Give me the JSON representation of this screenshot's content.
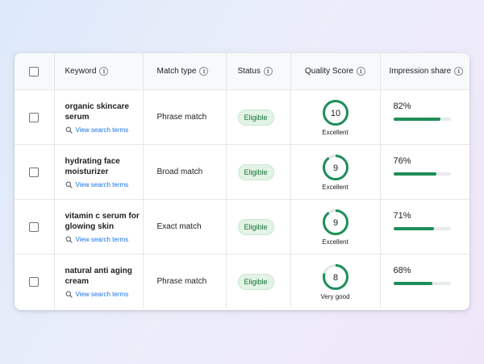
{
  "colors": {
    "link": "#1a73e8",
    "eligible_bg": "#e3f3e6",
    "eligible_text": "#137333",
    "progress": "#1e8e5a",
    "ring": "#1e8e5a"
  },
  "headers": {
    "keyword": "Keyword",
    "match_type": "Match type",
    "status": "Status",
    "quality_score": "Quality Score",
    "impression_share": "Impression share"
  },
  "rows": [
    {
      "keyword_line1": "organic skincare",
      "keyword_line2": "serum",
      "link": "View search terms",
      "match_type": "Phrase match",
      "status": "Eligible",
      "quality_score": "10",
      "quality_fraction": 1.0,
      "quality_label": "Excellent",
      "impression_share": "82%",
      "impression_fraction": 0.82
    },
    {
      "keyword_line1": "hydrating face",
      "keyword_line2": "moisturizer",
      "link": "View search terms",
      "match_type": "Broad match",
      "status": "Eligible",
      "quality_score": "9",
      "quality_fraction": 0.9,
      "quality_label": "Excellent",
      "impression_share": "76%",
      "impression_fraction": 0.76
    },
    {
      "keyword_line1": "vitamin c serum for",
      "keyword_line2": "glowing skin",
      "link": "View search terms",
      "match_type": "Exact match",
      "status": "Eligible",
      "quality_score": "9",
      "quality_fraction": 0.9,
      "quality_label": "Excellent",
      "impression_share": "71%",
      "impression_fraction": 0.71
    },
    {
      "keyword_line1": "natural anti aging",
      "keyword_line2": "cream",
      "link": "View search terms",
      "match_type": "Phrase match",
      "status": "Eligible",
      "quality_score": "8",
      "quality_fraction": 0.8,
      "quality_label": "Very good",
      "impression_share": "68%",
      "impression_fraction": 0.68
    }
  ]
}
